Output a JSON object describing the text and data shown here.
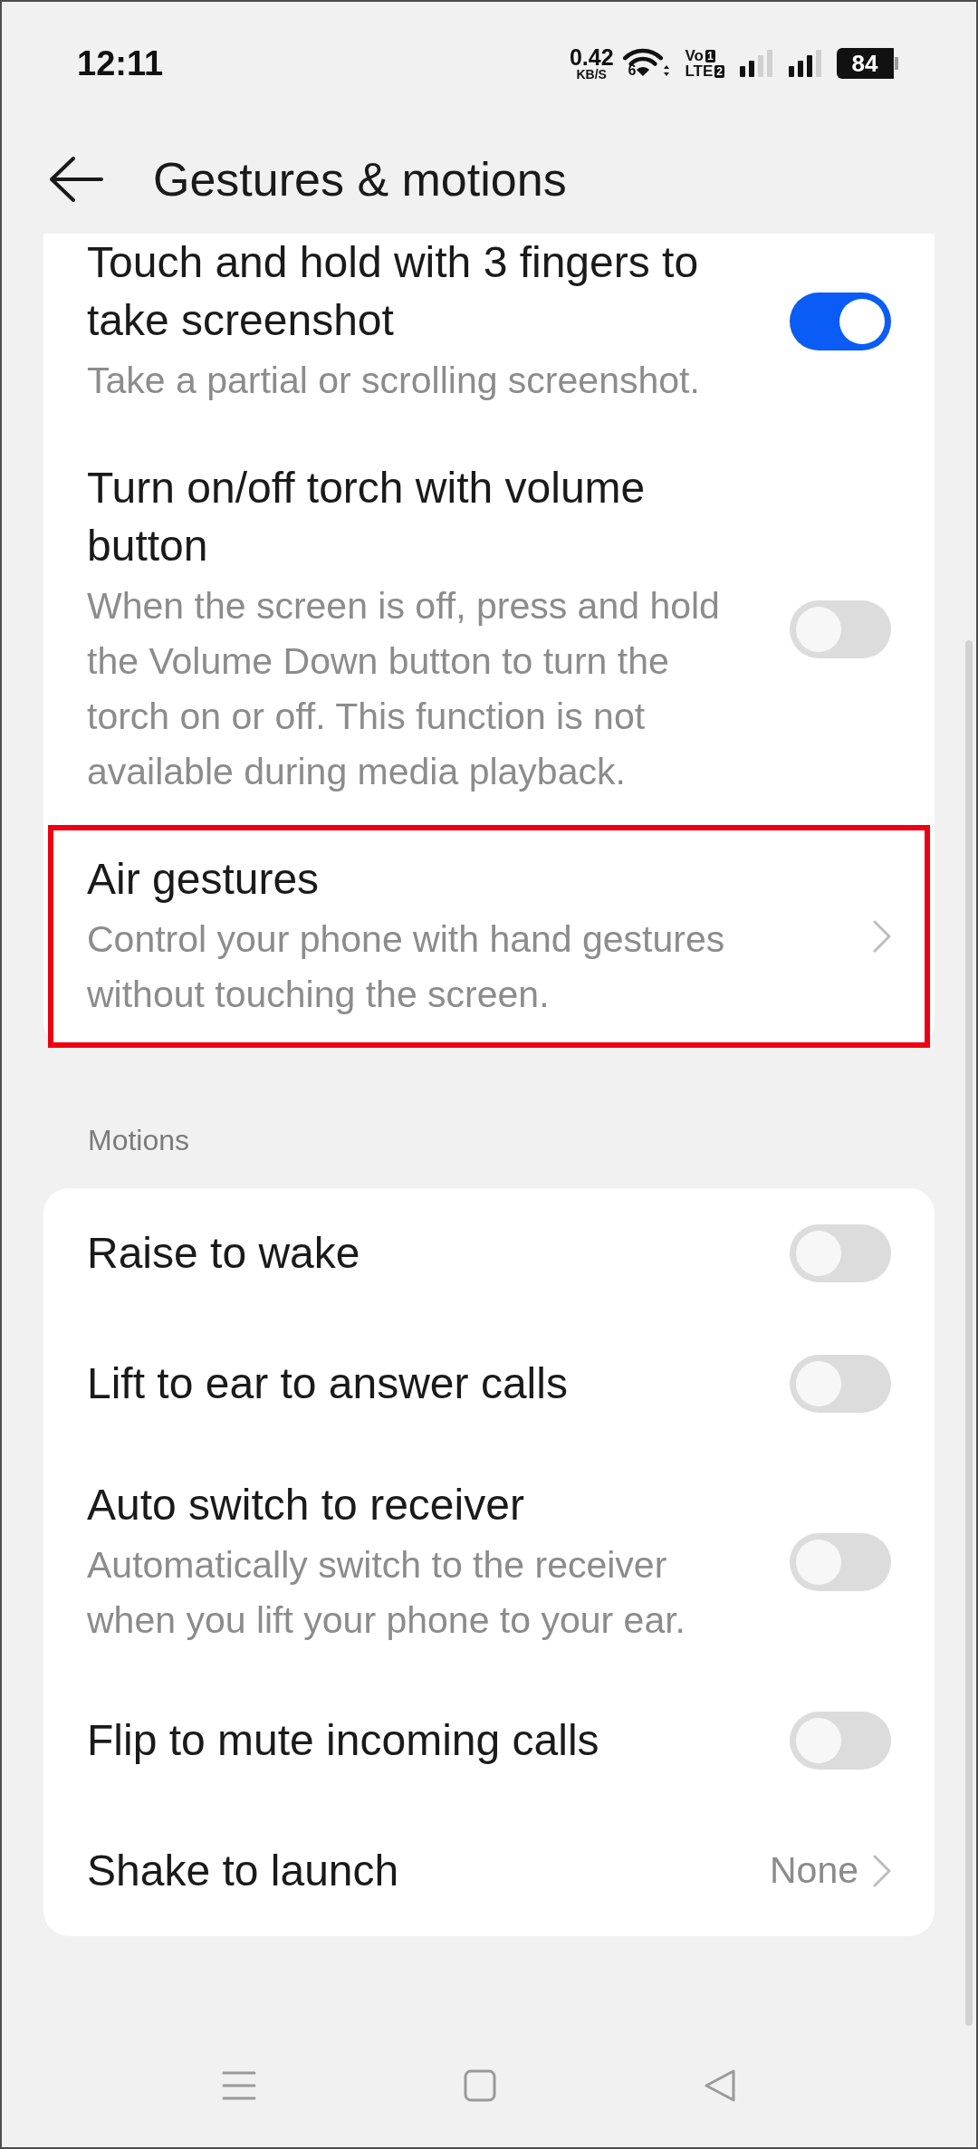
{
  "status_bar": {
    "time": "12:11",
    "net_speed": "0.42",
    "net_speed_unit": "KB/S",
    "wifi_label": "6",
    "volte": [
      {
        "label": "Vo",
        "sim": "1"
      },
      {
        "label": "LTE",
        "sim": "2"
      }
    ],
    "battery": "84"
  },
  "header": {
    "title": "Gestures & motions"
  },
  "sections": [
    {
      "items": [
        {
          "kind": "toggle",
          "title": "Touch and hold with 3 fingers to take screenshot",
          "description": "Take a partial or scrolling screenshot.",
          "on": true,
          "highlighted": false
        },
        {
          "kind": "toggle",
          "title": "Turn on/off torch with volume button",
          "description": "When the screen is off, press and hold the Volume Down button to turn the torch on or off. This function is not available during media playback.",
          "on": false,
          "highlighted": false
        },
        {
          "kind": "link",
          "title": "Air gestures",
          "description": "Control your phone with hand gestures without touching the screen.",
          "highlighted": true
        }
      ]
    },
    {
      "title": "Motions",
      "items": [
        {
          "kind": "toggle",
          "title": "Raise to wake",
          "on": false,
          "highlighted": false
        },
        {
          "kind": "toggle",
          "title": "Lift to ear to answer calls",
          "on": false,
          "highlighted": false
        },
        {
          "kind": "toggle",
          "title": "Auto switch to receiver",
          "description": "Automatically switch to the receiver when you lift your phone to your ear.",
          "on": false,
          "highlighted": false
        },
        {
          "kind": "toggle",
          "title": "Flip to mute incoming calls",
          "on": false,
          "highlighted": false
        },
        {
          "kind": "link",
          "title": "Shake to launch",
          "value": "None",
          "highlighted": false
        }
      ]
    }
  ]
}
